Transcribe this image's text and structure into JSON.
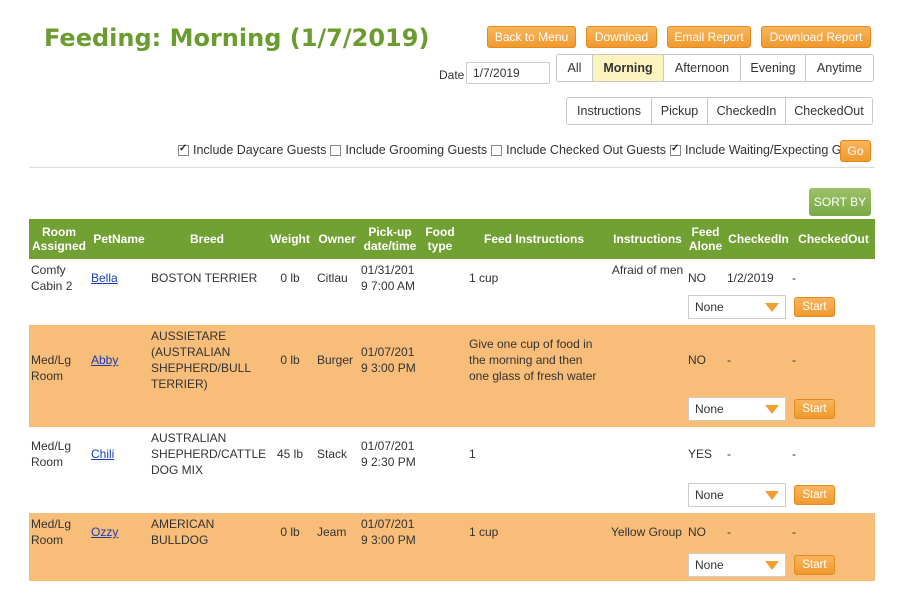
{
  "page_title": "Feeding: Morning (1/7/2019)",
  "toolbar": {
    "back": "Back to Menu",
    "download": "Download",
    "email": "Email Report",
    "download_report": "Download Report"
  },
  "date": {
    "label": "Date",
    "value": "1/7/2019"
  },
  "time_tabs": [
    "All",
    "Morning",
    "Afternoon",
    "Evening",
    "Anytime"
  ],
  "active_time_tab": "Morning",
  "view_tabs": [
    "Instructions",
    "Pickup",
    "CheckedIn",
    "CheckedOut"
  ],
  "filters": [
    {
      "label": "Include Daycare Guests",
      "checked": true
    },
    {
      "label": "Include Grooming Guests",
      "checked": false
    },
    {
      "label": "Include Checked Out Guests",
      "checked": false
    },
    {
      "label": "Include Waiting/Expecting Guests",
      "checked": true
    }
  ],
  "go_label": "Go",
  "sort_label": "SORT BY",
  "columns": [
    "Room Assigned",
    "PetName",
    "Breed",
    "Weight",
    "Owner",
    "Pick-up date/time",
    "Food type",
    "Feed Instructions",
    "Instructions",
    "Feed Alone",
    "CheckedIn",
    "CheckedOut"
  ],
  "rows": [
    {
      "room": "Comfy Cabin 2",
      "pet": "Bella",
      "breed": "BOSTON TERRIER",
      "weight": "0 lb",
      "owner": "Citlau",
      "pickup": "01/31/2019 7:00 AM",
      "food_type": "",
      "feed_instructions": "1 cup",
      "instructions": "Afraid of men",
      "feed_alone": "NO",
      "checked_in": "1/2/2019",
      "checked_out": "-",
      "select": "None",
      "start": "Start"
    },
    {
      "room": "Med/Lg Room",
      "pet": "Abby",
      "breed": "AUSSIETARE (AUSTRALIAN SHEPHERD/BULL TERRIER)",
      "weight": "0 lb",
      "owner": "Burger",
      "pickup": "01/07/2019 3:00 PM",
      "food_type": "",
      "feed_instructions": "Give one cup of food in the morning and then one glass of fresh water",
      "instructions": "",
      "feed_alone": "NO",
      "checked_in": "-",
      "checked_out": "-",
      "select": "None",
      "start": "Start"
    },
    {
      "room": "Med/Lg Room",
      "pet": "Chili",
      "breed": "AUSTRALIAN SHEPHERD/CATTLE DOG MIX",
      "weight": "45 lb",
      "owner": "Stack",
      "pickup": "01/07/2019 2:30 PM",
      "food_type": "",
      "feed_instructions": "1",
      "instructions": "",
      "feed_alone": "YES",
      "checked_in": "-",
      "checked_out": "-",
      "select": "None",
      "start": "Start"
    },
    {
      "room": "Med/Lg Room",
      "pet": "Ozzy",
      "breed": "AMERICAN BULLDOG",
      "weight": "0 lb",
      "owner": "Jeam",
      "pickup": "01/07/2019 3:00 PM",
      "food_type": "",
      "feed_instructions": "1 cup",
      "instructions": "Yellow Group",
      "feed_alone": "NO",
      "checked_in": "-",
      "checked_out": "-",
      "select": "None",
      "start": "Start"
    }
  ]
}
